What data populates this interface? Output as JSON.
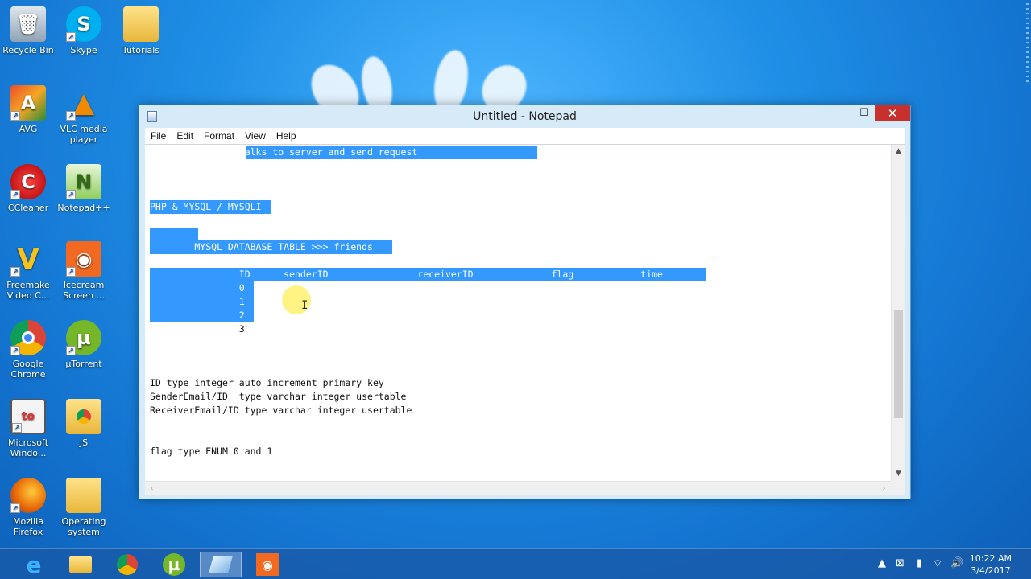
{
  "desktop": {
    "icons": [
      {
        "label": "Recycle Bin",
        "icon": "recycle-bin-icon"
      },
      {
        "label": "Skype",
        "icon": "skype-icon"
      },
      {
        "label": "Tutorials",
        "icon": "folder-icon"
      },
      {
        "label": "AVG",
        "icon": "avg-icon"
      },
      {
        "label": "VLC media player",
        "icon": "vlc-icon"
      },
      {
        "label": "CCleaner",
        "icon": "ccleaner-icon"
      },
      {
        "label": "Notepad++",
        "icon": "notepadpp-icon"
      },
      {
        "label": "Freemake Video C...",
        "icon": "freemake-icon"
      },
      {
        "label": "Icecream Screen ...",
        "icon": "icecream-icon"
      },
      {
        "label": "Google Chrome",
        "icon": "chrome-icon"
      },
      {
        "label": "µTorrent",
        "icon": "utorrent-icon"
      },
      {
        "label": "Microsoft Windo...",
        "icon": "windows-movie-icon"
      },
      {
        "label": "JS",
        "icon": "folder-chrome-icon"
      },
      {
        "label": "Mozilla Firefox",
        "icon": "firefox-icon"
      },
      {
        "label": "Operating system",
        "icon": "folder-icon"
      }
    ]
  },
  "window": {
    "title": "Untitled - Notepad",
    "controls": {
      "minimize": "—",
      "maximize": "☐",
      "close": "✕"
    },
    "menu": [
      "File",
      "Edit",
      "Format",
      "View",
      "Help"
    ]
  },
  "editor": {
    "lines": [
      "                talks to server and send request",
      "PHP & MYSQL / MYSQLI",
      "        MYSQL DATABASE TABLE >>> friends",
      "                ID      senderID                receiverID              flag            time",
      "                0",
      "                1",
      "                2",
      "                3",
      "ID type integer auto increment primary key",
      "SenderEmail/ID  type varchar integer usertable",
      "ReceiverEmail/ID type varchar integer usertable",
      "flag type ENUM 0 and 1"
    ]
  },
  "taskbar": {
    "apps": [
      {
        "icon": "internet-explorer-icon"
      },
      {
        "icon": "file-explorer-icon"
      },
      {
        "icon": "chrome-icon"
      },
      {
        "icon": "utorrent-icon"
      },
      {
        "icon": "notepad-icon",
        "active": true
      },
      {
        "icon": "icecream-icon"
      }
    ],
    "clock": {
      "time": "10:22 AM",
      "date": "3/4/2017"
    }
  }
}
